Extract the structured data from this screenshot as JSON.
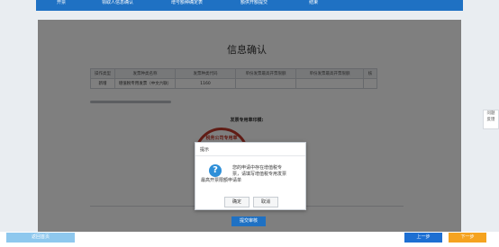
{
  "steps": [
    "开票",
    "领取人信息确认",
    "增号额种确定表",
    "额供开额提交",
    "结束"
  ],
  "page": {
    "title": "信息确认"
  },
  "table": {
    "headers": [
      "操作类型",
      "发票种类名称",
      "发票种类代码",
      "单份发票最高开票限额",
      "单份发票最高开票限额",
      "核"
    ],
    "rows": [
      [
        "新增",
        "增值税专用发票（中文六联）",
        "1160",
        "",
        "",
        ""
      ]
    ]
  },
  "seal": {
    "label": "发票专用章印模:",
    "text": "税务公司专用章"
  },
  "dialog": {
    "title": "提示",
    "message_line1": "您的申请中存在增值税专",
    "message_line2": "票，请填写增值税专用发票",
    "message_line3": "最高开票限额申请单",
    "confirm": "确定",
    "cancel": "取消"
  },
  "submit_button": "提交审核",
  "side_tab": {
    "line1": "问题",
    "line2": "反馈"
  },
  "footer": {
    "return": "返回首页",
    "prev": "上一步",
    "next": "下一步"
  },
  "colors": {
    "topbar": "#1f71c3",
    "prev": "#1d6fd2",
    "next": "#f5a320",
    "return": "#8ec8ee"
  }
}
